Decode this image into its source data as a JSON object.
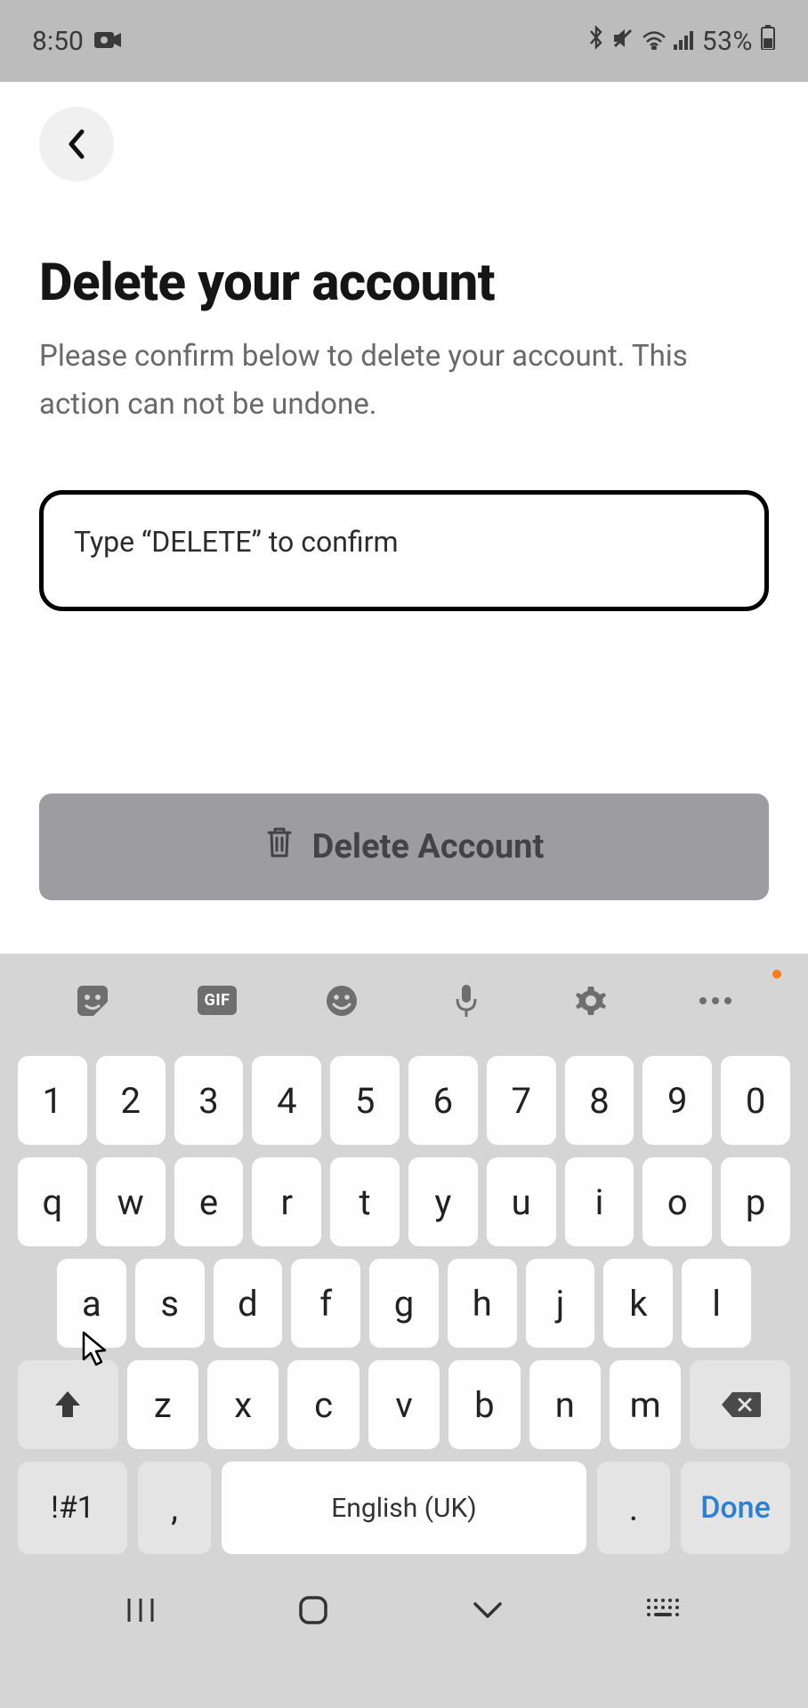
{
  "status_bar": {
    "time": "8:50",
    "battery_percent": "53%"
  },
  "content": {
    "title": "Delete your account",
    "subtitle": "Please confirm below to delete your account. This action can not be undone.",
    "input_placeholder": "Type “DELETE” to confirm",
    "delete_button_label": "Delete Account"
  },
  "keyboard": {
    "toolbar": {
      "gif_label": "GIF"
    },
    "row_num": [
      "1",
      "2",
      "3",
      "4",
      "5",
      "6",
      "7",
      "8",
      "9",
      "0"
    ],
    "row_q": [
      "q",
      "w",
      "e",
      "r",
      "t",
      "y",
      "u",
      "i",
      "o",
      "p"
    ],
    "row_a": [
      "a",
      "s",
      "d",
      "f",
      "g",
      "h",
      "j",
      "k",
      "l"
    ],
    "row_z": [
      "z",
      "x",
      "c",
      "v",
      "b",
      "n",
      "m"
    ],
    "symnum": "!#1",
    "comma": ",",
    "space_label": "English (UK)",
    "period": ".",
    "done": "Done"
  }
}
